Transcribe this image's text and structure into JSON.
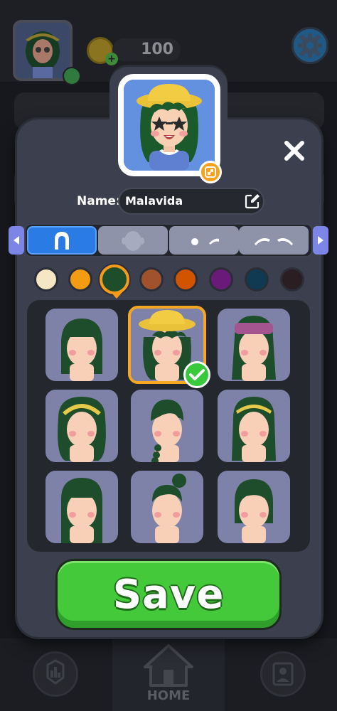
{
  "background": {
    "coins": "100",
    "bottom_nav": {
      "home_label": "HOME"
    }
  },
  "dialog": {
    "name_label": "Name:",
    "name_value": "Malavida",
    "categories": [
      {
        "name": "hair",
        "icon": "hair-icon",
        "active": true
      },
      {
        "name": "face",
        "icon": "face-shape-icon",
        "active": false
      },
      {
        "name": "eyes",
        "icon": "eyes-icon",
        "active": false
      },
      {
        "name": "eyebrows",
        "icon": "eyebrows-icon",
        "active": false
      }
    ],
    "colors": [
      "#f5e6c4",
      "#f39c12",
      "#1e4d2b",
      "#a0522d",
      "#d35400",
      "#6a1b7a",
      "#0f3a52",
      "#2a1e23"
    ],
    "selected_color": "#1e4d2b",
    "hair_styles": [
      {
        "style": "bob-bangs",
        "selected": false
      },
      {
        "style": "curly-with-hat",
        "selected": true
      },
      {
        "style": "long-with-headband",
        "selected": false
      },
      {
        "style": "curly-with-headband",
        "selected": false
      },
      {
        "style": "side-braid",
        "selected": false
      },
      {
        "style": "long-with-hairband",
        "selected": false
      },
      {
        "style": "long-straight-bangs",
        "selected": false
      },
      {
        "style": "top-bun",
        "selected": false
      },
      {
        "style": "short-bob",
        "selected": false
      }
    ],
    "save_label": "Save"
  }
}
